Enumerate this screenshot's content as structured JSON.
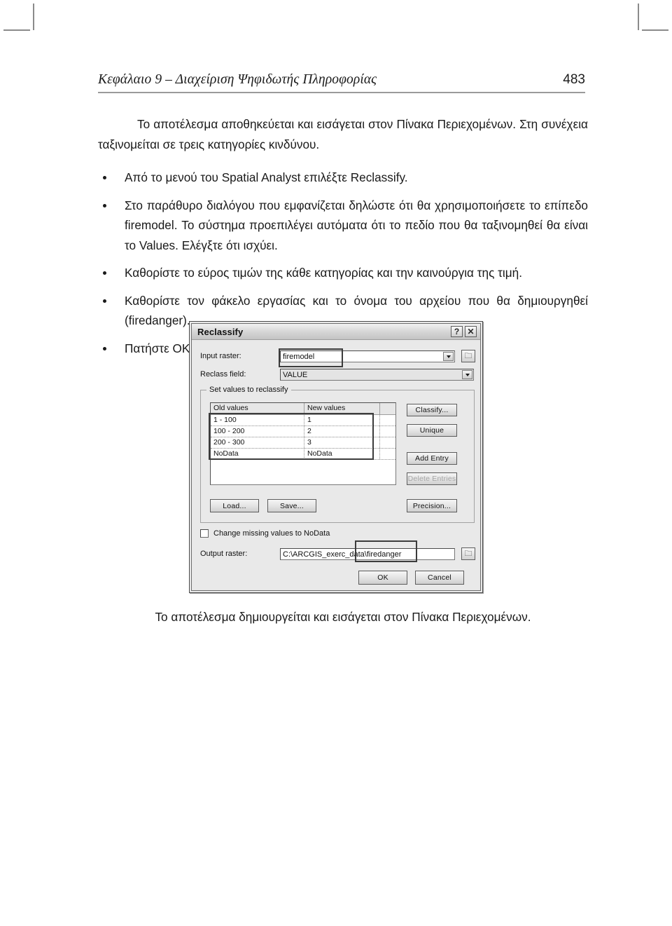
{
  "page": {
    "running_head": "Κεφάλαιο 9 – Διαχείριση Ψηφιδωτής Πληροφορίας",
    "page_number": "483"
  },
  "body": {
    "intro_paragraph": "Το αποτέλεσμα αποθηκεύεται και εισάγεται στον Πίνακα Περιεχομένων. Στη συνέχεια ταξινομείται σε τρεις κατηγορίες κινδύνου.",
    "bullets": [
      "Από το μενού του Spatial Analyst επιλέξτε Reclassify.",
      "Στο παράθυρο διαλόγου που εμφανίζεται δηλώστε ότι θα χρησιμοποιήσετε το επίπεδο firemodel. Το σύστημα προεπιλέγει αυτόματα ότι το πεδίο που θα ταξινομηθεί θα είναι το Values. Ελέγξτε ότι ισχύει.",
      "Καθορίστε το εύρος τιμών της κάθε κατηγορίας και την καινούργια της τιμή.",
      "Καθορίστε τον φάκελο εργασίας και το όνομα του αρχείου που θα δημιουργηθεί (firedanger).",
      "Πατήστε ΟΚ."
    ],
    "closing_paragraph": "Το αποτέλεσμα δημιουργείται και εισάγεται στον Πίνακα Περιεχομένων."
  },
  "dialog": {
    "title": "Reclassify",
    "title_buttons": {
      "help": "?",
      "close": "✕"
    },
    "input_raster": {
      "label": "Input raster:",
      "value": "firemodel"
    },
    "reclass_field": {
      "label": "Reclass field:",
      "value": "VALUE"
    },
    "group": {
      "legend": "Set values to reclassify",
      "table": {
        "columns": [
          "Old values",
          "New values",
          ""
        ],
        "rows": [
          [
            "1 - 100",
            "1",
            ""
          ],
          [
            "100 - 200",
            "2",
            ""
          ],
          [
            "200 - 300",
            "3",
            ""
          ],
          [
            "NoData",
            "NoData",
            ""
          ]
        ]
      },
      "side_buttons": [
        {
          "label": "Classify...",
          "enabled": true
        },
        {
          "label": "Unique",
          "enabled": true
        },
        {
          "label": "Add Entry",
          "enabled": true
        },
        {
          "label": "Delete Entries",
          "enabled": false
        }
      ],
      "bottom_buttons": [
        {
          "label": "Load..."
        },
        {
          "label": "Save..."
        },
        {
          "label": "Precision..."
        }
      ]
    },
    "change_missing": {
      "label": "Change missing values to NoData",
      "checked": false
    },
    "output_raster": {
      "label": "Output raster:",
      "value": "C:\\ARCGIS_exerc_data\\firedanger"
    },
    "actions": {
      "ok": "OK",
      "cancel": "Cancel"
    },
    "folder_icon": "🗀"
  },
  "colors": {
    "dialog_face": "#e9e9e9",
    "field_bg": "#ffffff",
    "text": "#111111",
    "disabled_text": "#a6a6a6",
    "rule": "#9a9a9a"
  }
}
